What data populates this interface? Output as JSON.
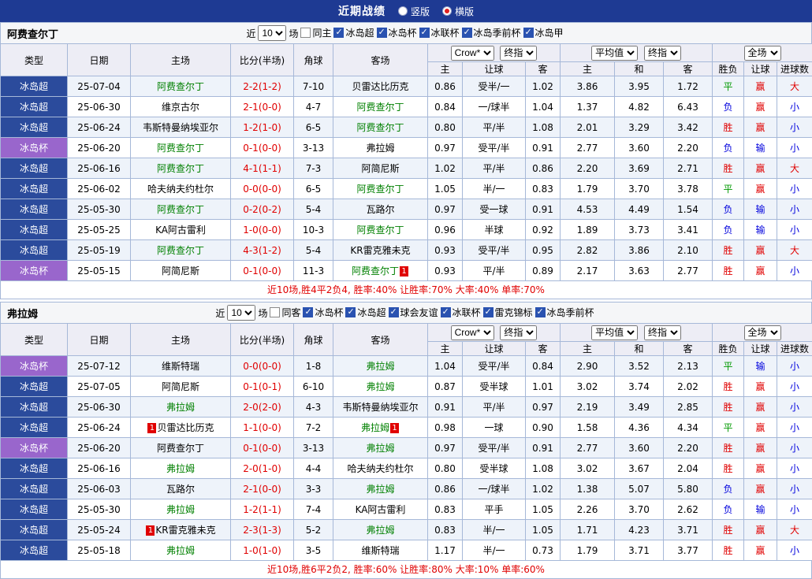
{
  "header": {
    "title": "近期战绩",
    "layout_options": [
      {
        "label": "竖版",
        "selected": false
      },
      {
        "label": "横版",
        "selected": true
      }
    ]
  },
  "ui": {
    "near": "近",
    "games": "场",
    "company_dropdown": "Crow*",
    "final_dropdown": "终指",
    "euro_dropdown": "平均值",
    "scope_dropdown": "全场"
  },
  "col_headers": {
    "type": "类型",
    "date": "日期",
    "home": "主场",
    "score": "比分(半场)",
    "corner": "角球",
    "away": "客场",
    "asian": [
      "主",
      "让球",
      "客"
    ],
    "euro": [
      "主",
      "和",
      "客"
    ],
    "result": [
      "胜负",
      "让球",
      "进球数"
    ]
  },
  "sections": [
    {
      "team": "阿费查尔丁",
      "filter": {
        "count": "10",
        "leagues": [
          {
            "label": "同主",
            "checked": false
          },
          {
            "label": "冰岛超",
            "checked": true
          },
          {
            "label": "冰岛杯",
            "checked": true
          },
          {
            "label": "冰联杯",
            "checked": true
          },
          {
            "label": "冰岛季前杯",
            "checked": true
          },
          {
            "label": "冰岛甲",
            "checked": true
          }
        ]
      },
      "rows": [
        {
          "league": "冰岛超",
          "league_type": "super",
          "date": "25-07-04",
          "home": "阿费查尔丁",
          "home_focus": true,
          "score": "2-2(1-2)",
          "corner": "7-10",
          "away": "贝雷达比历克",
          "away_focus": false,
          "asian_home": "0.86",
          "handicap": "受半/一",
          "asian_away": "1.02",
          "euro_home": "3.86",
          "euro_draw": "3.95",
          "euro_away": "1.72",
          "result": "平",
          "handicap_result": "赢",
          "goals_result": "大"
        },
        {
          "league": "冰岛超",
          "league_type": "super",
          "date": "25-06-30",
          "home": "维京古尔",
          "home_focus": false,
          "score": "2-1(0-0)",
          "corner": "4-7",
          "away": "阿费查尔丁",
          "away_focus": true,
          "asian_home": "0.84",
          "handicap": "一/球半",
          "asian_away": "1.04",
          "euro_home": "1.37",
          "euro_draw": "4.82",
          "euro_away": "6.43",
          "result": "负",
          "handicap_result": "赢",
          "goals_result": "小"
        },
        {
          "league": "冰岛超",
          "league_type": "super",
          "date": "25-06-24",
          "home": "韦斯特曼纳埃亚尔",
          "home_focus": false,
          "score": "1-2(1-0)",
          "corner": "6-5",
          "away": "阿费查尔丁",
          "away_focus": true,
          "asian_home": "0.80",
          "handicap": "平/半",
          "asian_away": "1.08",
          "euro_home": "2.01",
          "euro_draw": "3.29",
          "euro_away": "3.42",
          "result": "胜",
          "handicap_result": "赢",
          "goals_result": "小"
        },
        {
          "league": "冰岛杯",
          "league_type": "cup",
          "date": "25-06-20",
          "home": "阿费查尔丁",
          "home_focus": true,
          "score": "0-1(0-0)",
          "corner": "3-13",
          "away": "弗拉姆",
          "away_focus": false,
          "asian_home": "0.97",
          "handicap": "受平/半",
          "asian_away": "0.91",
          "euro_home": "2.77",
          "euro_draw": "3.60",
          "euro_away": "2.20",
          "result": "负",
          "handicap_result": "输",
          "goals_result": "小"
        },
        {
          "league": "冰岛超",
          "league_type": "super",
          "date": "25-06-16",
          "home": "阿费查尔丁",
          "home_focus": true,
          "score": "4-1(1-1)",
          "corner": "7-3",
          "away": "阿简尼斯",
          "away_focus": false,
          "asian_home": "1.02",
          "handicap": "平/半",
          "asian_away": "0.86",
          "euro_home": "2.20",
          "euro_draw": "3.69",
          "euro_away": "2.71",
          "result": "胜",
          "handicap_result": "赢",
          "goals_result": "大"
        },
        {
          "league": "冰岛超",
          "league_type": "super",
          "date": "25-06-02",
          "home": "哈夫纳夫约杜尔",
          "home_focus": false,
          "score": "0-0(0-0)",
          "corner": "6-5",
          "away": "阿费查尔丁",
          "away_focus": true,
          "asian_home": "1.05",
          "handicap": "半/一",
          "asian_away": "0.83",
          "euro_home": "1.79",
          "euro_draw": "3.70",
          "euro_away": "3.78",
          "result": "平",
          "handicap_result": "赢",
          "goals_result": "小"
        },
        {
          "league": "冰岛超",
          "league_type": "super",
          "date": "25-05-30",
          "home": "阿费查尔丁",
          "home_focus": true,
          "score": "0-2(0-2)",
          "corner": "5-4",
          "away": "瓦路尔",
          "away_focus": false,
          "asian_home": "0.97",
          "handicap": "受一球",
          "asian_away": "0.91",
          "euro_home": "4.53",
          "euro_draw": "4.49",
          "euro_away": "1.54",
          "result": "负",
          "handicap_result": "输",
          "goals_result": "小"
        },
        {
          "league": "冰岛超",
          "league_type": "super",
          "date": "25-05-25",
          "home": "KA阿古雷利",
          "home_focus": false,
          "score": "1-0(0-0)",
          "corner": "10-3",
          "away": "阿费查尔丁",
          "away_focus": true,
          "asian_home": "0.96",
          "handicap": "半球",
          "asian_away": "0.92",
          "euro_home": "1.89",
          "euro_draw": "3.73",
          "euro_away": "3.41",
          "result": "负",
          "handicap_result": "输",
          "goals_result": "小"
        },
        {
          "league": "冰岛超",
          "league_type": "super",
          "date": "25-05-19",
          "home": "阿费查尔丁",
          "home_focus": true,
          "score": "4-3(1-2)",
          "corner": "5-4",
          "away": "KR雷克雅未克",
          "away_focus": false,
          "asian_home": "0.93",
          "handicap": "受平/半",
          "asian_away": "0.95",
          "euro_home": "2.82",
          "euro_draw": "3.86",
          "euro_away": "2.10",
          "result": "胜",
          "handicap_result": "赢",
          "goals_result": "大"
        },
        {
          "league": "冰岛杯",
          "league_type": "cup",
          "date": "25-05-15",
          "home": "阿简尼斯",
          "home_focus": false,
          "score": "0-1(0-0)",
          "corner": "11-3",
          "away": "阿费查尔丁",
          "away_focus": true,
          "away_badge": "1",
          "asian_home": "0.93",
          "handicap": "平/半",
          "asian_away": "0.89",
          "euro_home": "2.17",
          "euro_draw": "3.63",
          "euro_away": "2.77",
          "result": "胜",
          "handicap_result": "赢",
          "goals_result": "小"
        }
      ],
      "summary": "近10场,胜4平2负4, 胜率:40% 让胜率:70% 大率:40% 单率:70%"
    },
    {
      "team": "弗拉姆",
      "filter": {
        "count": "10",
        "leagues": [
          {
            "label": "同客",
            "checked": false
          },
          {
            "label": "冰岛杯",
            "checked": true
          },
          {
            "label": "冰岛超",
            "checked": true
          },
          {
            "label": "球会友谊",
            "checked": true
          },
          {
            "label": "冰联杯",
            "checked": true
          },
          {
            "label": "雷克锦标",
            "checked": true
          },
          {
            "label": "冰岛季前杯",
            "checked": true
          }
        ]
      },
      "rows": [
        {
          "league": "冰岛杯",
          "league_type": "cup",
          "date": "25-07-12",
          "home": "维斯特瑞",
          "home_focus": false,
          "score": "0-0(0-0)",
          "corner": "1-8",
          "away": "弗拉姆",
          "away_focus": true,
          "asian_home": "1.04",
          "handicap": "受平/半",
          "asian_away": "0.84",
          "euro_home": "2.90",
          "euro_draw": "3.52",
          "euro_away": "2.13",
          "result": "平",
          "handicap_result": "输",
          "goals_result": "小"
        },
        {
          "league": "冰岛超",
          "league_type": "super",
          "date": "25-07-05",
          "home": "阿简尼斯",
          "home_focus": false,
          "score": "0-1(0-1)",
          "corner": "6-10",
          "away": "弗拉姆",
          "away_focus": true,
          "asian_home": "0.87",
          "handicap": "受半球",
          "asian_away": "1.01",
          "euro_home": "3.02",
          "euro_draw": "3.74",
          "euro_away": "2.02",
          "result": "胜",
          "handicap_result": "赢",
          "goals_result": "小"
        },
        {
          "league": "冰岛超",
          "league_type": "super",
          "date": "25-06-30",
          "home": "弗拉姆",
          "home_focus": true,
          "score": "2-0(2-0)",
          "corner": "4-3",
          "away": "韦斯特曼纳埃亚尔",
          "away_focus": false,
          "asian_home": "0.91",
          "handicap": "平/半",
          "asian_away": "0.97",
          "euro_home": "2.19",
          "euro_draw": "3.49",
          "euro_away": "2.85",
          "result": "胜",
          "handicap_result": "赢",
          "goals_result": "小"
        },
        {
          "league": "冰岛超",
          "league_type": "super",
          "date": "25-06-24",
          "home": "贝雷达比历克",
          "home_focus": false,
          "home_badge": "1",
          "score": "1-1(0-0)",
          "corner": "7-2",
          "away": "弗拉姆",
          "away_focus": true,
          "away_badge": "1",
          "asian_home": "0.98",
          "handicap": "一球",
          "asian_away": "0.90",
          "euro_home": "1.58",
          "euro_draw": "4.36",
          "euro_away": "4.34",
          "result": "平",
          "handicap_result": "赢",
          "goals_result": "小"
        },
        {
          "league": "冰岛杯",
          "league_type": "cup",
          "date": "25-06-20",
          "home": "阿费查尔丁",
          "home_focus": false,
          "score": "0-1(0-0)",
          "corner": "3-13",
          "away": "弗拉姆",
          "away_focus": true,
          "asian_home": "0.97",
          "handicap": "受平/半",
          "asian_away": "0.91",
          "euro_home": "2.77",
          "euro_draw": "3.60",
          "euro_away": "2.20",
          "result": "胜",
          "handicap_result": "赢",
          "goals_result": "小"
        },
        {
          "league": "冰岛超",
          "league_type": "super",
          "date": "25-06-16",
          "home": "弗拉姆",
          "home_focus": true,
          "score": "2-0(1-0)",
          "corner": "4-4",
          "away": "哈夫纳夫约杜尔",
          "away_focus": false,
          "asian_home": "0.80",
          "handicap": "受半球",
          "asian_away": "1.08",
          "euro_home": "3.02",
          "euro_draw": "3.67",
          "euro_away": "2.04",
          "result": "胜",
          "handicap_result": "赢",
          "goals_result": "小"
        },
        {
          "league": "冰岛超",
          "league_type": "super",
          "date": "25-06-03",
          "home": "瓦路尔",
          "home_focus": false,
          "score": "2-1(0-0)",
          "corner": "3-3",
          "away": "弗拉姆",
          "away_focus": true,
          "asian_home": "0.86",
          "handicap": "一/球半",
          "asian_away": "1.02",
          "euro_home": "1.38",
          "euro_draw": "5.07",
          "euro_away": "5.80",
          "result": "负",
          "handicap_result": "赢",
          "goals_result": "小"
        },
        {
          "league": "冰岛超",
          "league_type": "super",
          "date": "25-05-30",
          "home": "弗拉姆",
          "home_focus": true,
          "score": "1-2(1-1)",
          "corner": "7-4",
          "away": "KA阿古雷利",
          "away_focus": false,
          "asian_home": "0.83",
          "handicap": "平手",
          "asian_away": "1.05",
          "euro_home": "2.26",
          "euro_draw": "3.70",
          "euro_away": "2.62",
          "result": "负",
          "handicap_result": "输",
          "goals_result": "小"
        },
        {
          "league": "冰岛超",
          "league_type": "super",
          "date": "25-05-24",
          "home": "KR雷克雅未克",
          "home_focus": false,
          "home_badge": "1",
          "score": "2-3(1-3)",
          "corner": "5-2",
          "away": "弗拉姆",
          "away_focus": true,
          "asian_home": "0.83",
          "handicap": "半/一",
          "asian_away": "1.05",
          "euro_home": "1.71",
          "euro_draw": "4.23",
          "euro_away": "3.71",
          "result": "胜",
          "handicap_result": "赢",
          "goals_result": "大"
        },
        {
          "league": "冰岛超",
          "league_type": "super",
          "date": "25-05-18",
          "home": "弗拉姆",
          "home_focus": true,
          "score": "1-0(1-0)",
          "corner": "3-5",
          "away": "维斯特瑞",
          "away_focus": false,
          "asian_home": "1.17",
          "handicap": "半/一",
          "asian_away": "0.73",
          "euro_home": "1.79",
          "euro_draw": "3.71",
          "euro_away": "3.77",
          "result": "胜",
          "handicap_result": "赢",
          "goals_result": "小"
        }
      ],
      "summary": "近10场,胜6平2负2, 胜率:60% 让胜率:80% 大率:10% 单率:60%"
    }
  ]
}
